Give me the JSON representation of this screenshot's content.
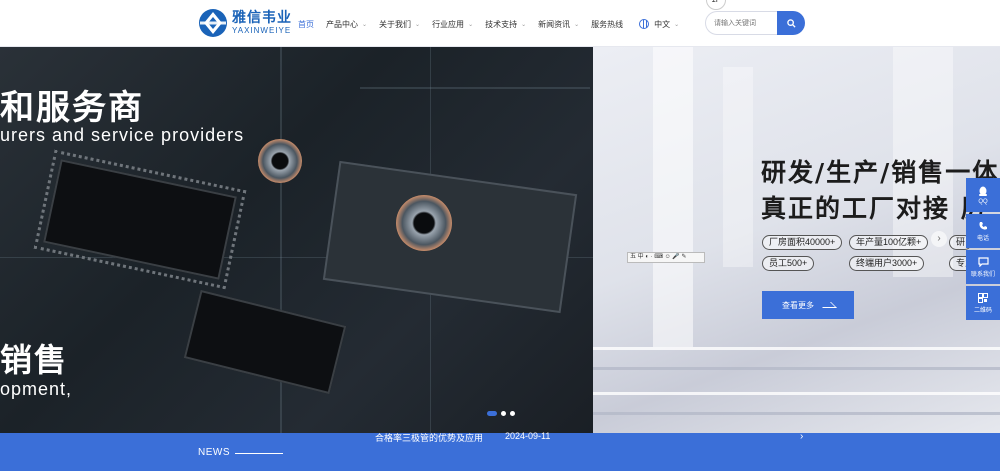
{
  "header": {
    "logo_cn": "雅信韦业",
    "logo_en": "YAXINWEIYE",
    "nav": [
      {
        "label": "首页",
        "active": true,
        "has_dropdown": false
      },
      {
        "label": "产品中心",
        "active": false,
        "has_dropdown": true
      },
      {
        "label": "关于我们",
        "active": false,
        "has_dropdown": true
      },
      {
        "label": "行业应用",
        "active": false,
        "has_dropdown": true
      },
      {
        "label": "技术支持",
        "active": false,
        "has_dropdown": true
      },
      {
        "label": "新闻资讯",
        "active": false,
        "has_dropdown": true
      },
      {
        "label": "服务热线",
        "active": false,
        "has_dropdown": false
      }
    ],
    "language": "中文",
    "search_placeholder": "请输入关键词",
    "top_badge": "1F",
    "accent_color": "#3b6fd8"
  },
  "banner": {
    "left_title": "和服务商",
    "left_subtitle": "urers and service providers",
    "left_title2": "销售",
    "left_subtitle2": "opment,",
    "right_title1": "研发/生产/销售一体",
    "right_title2": "真正的工厂对接 厉",
    "tags": [
      "厂房面积40000+",
      "年产量100亿颗+",
      "研",
      "员工500+",
      "终端用户3000+",
      "专业"
    ],
    "more_button": "查看更多",
    "ime_text": "五 中 ◐ · ⌨ ☺ 🎤 ✎",
    "slider_next": "›",
    "dots": [
      true,
      false,
      false
    ]
  },
  "side_toolbar": [
    {
      "icon": "qq-icon",
      "label": "QQ"
    },
    {
      "icon": "phone-icon",
      "label": "电话"
    },
    {
      "icon": "message-icon",
      "label": "联系我们"
    },
    {
      "icon": "qrcode-icon",
      "label": "二维码"
    }
  ],
  "news": {
    "label": "NEWS",
    "title": "合格率三极管的优势及应用",
    "date": "2024-09-11",
    "arrow": "›"
  }
}
